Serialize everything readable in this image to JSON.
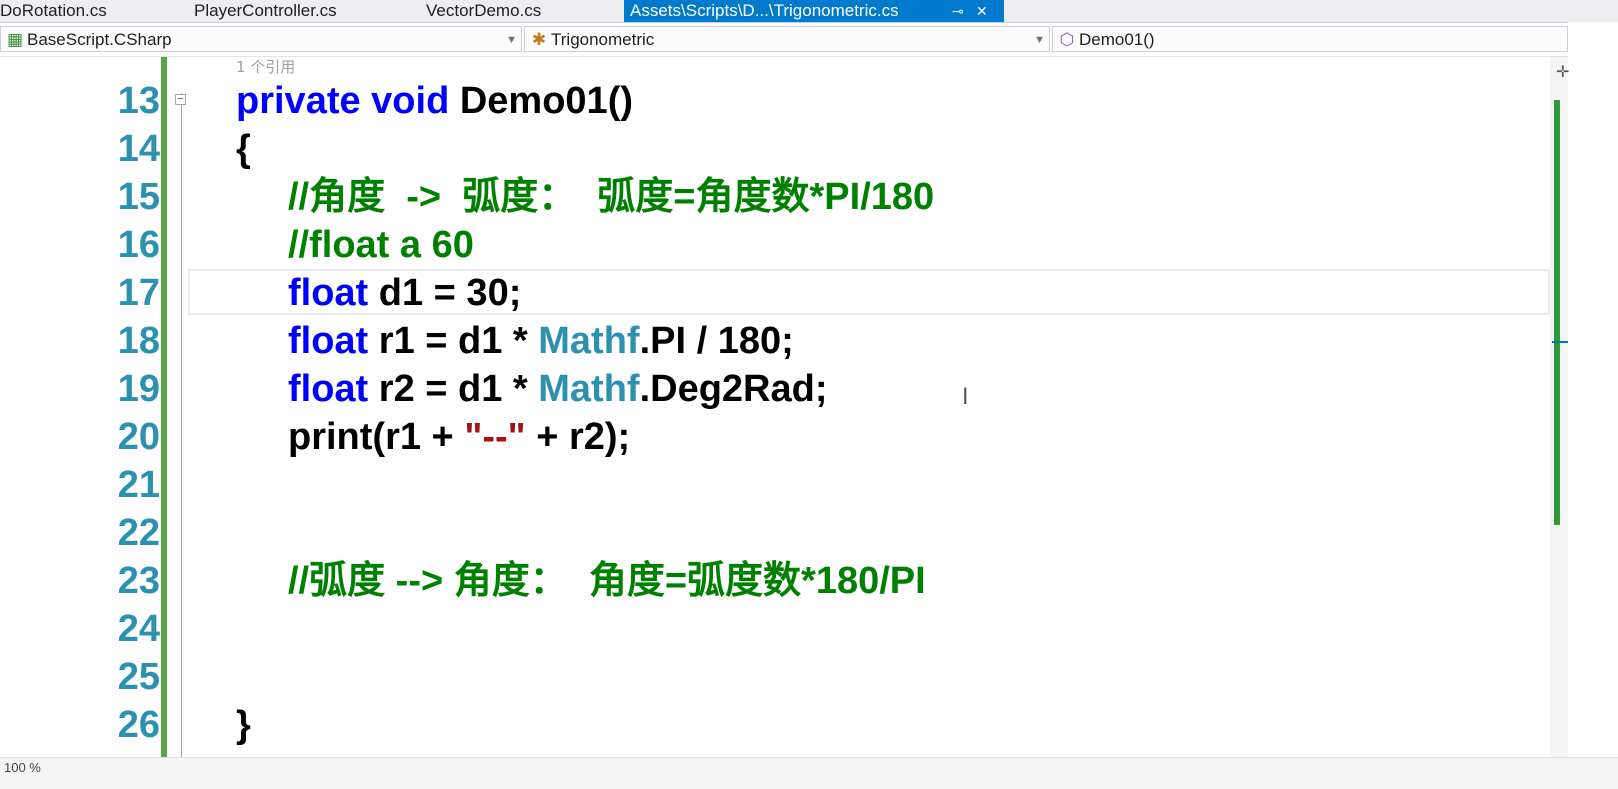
{
  "tabs": [
    {
      "label": "DoRotation.cs",
      "active": false
    },
    {
      "label": "PlayerController.cs",
      "active": false
    },
    {
      "label": "VectorDemo.cs",
      "active": false
    },
    {
      "label": "Assets\\Scripts\\D...\\Trigonometric.cs",
      "active": true
    }
  ],
  "tab_pin_icon": "pin-icon",
  "tab_close_icon": "close-icon",
  "nav": {
    "project": "BaseScript.CSharp",
    "class": "Trigonometric",
    "member": "Demo01()"
  },
  "editor": {
    "reference_hint": "1 个引用",
    "line_numbers": [
      "13",
      "14",
      "15",
      "16",
      "17",
      "18",
      "19",
      "20",
      "21",
      "22",
      "23",
      "24",
      "25",
      "26"
    ],
    "lines": [
      [
        {
          "t": "kw",
          "v": "private void "
        },
        {
          "t": "plain",
          "v": "Demo01()"
        }
      ],
      [
        {
          "t": "plain",
          "v": "{"
        }
      ],
      [
        {
          "t": "cm",
          "v": "//角度  ->  弧度：  弧度=角度数*PI/180"
        }
      ],
      [
        {
          "t": "cm",
          "v": "//float a 60"
        }
      ],
      [
        {
          "t": "kw",
          "v": "float "
        },
        {
          "t": "plain",
          "v": "d1 = 30;"
        }
      ],
      [
        {
          "t": "kw",
          "v": "float "
        },
        {
          "t": "plain",
          "v": "r1 = d1 * "
        },
        {
          "t": "type",
          "v": "Mathf"
        },
        {
          "t": "plain",
          "v": ".PI / 180;"
        }
      ],
      [
        {
          "t": "kw",
          "v": "float "
        },
        {
          "t": "plain",
          "v": "r2 = d1 * "
        },
        {
          "t": "type",
          "v": "Mathf"
        },
        {
          "t": "plain",
          "v": ".Deg2Rad;"
        }
      ],
      [
        {
          "t": "plain",
          "v": "print(r1 + "
        },
        {
          "t": "str",
          "v": "\"--\""
        },
        {
          "t": "plain",
          "v": " + r2);"
        }
      ],
      [],
      [],
      [
        {
          "t": "cm",
          "v": "//弧度 --> 角度：  角度=弧度数*180/PI"
        }
      ],
      [],
      [],
      [
        {
          "t": "plain",
          "v": "}"
        }
      ]
    ],
    "indent_levels": [
      0,
      0,
      1,
      1,
      1,
      1,
      1,
      1,
      0,
      0,
      1,
      0,
      0,
      0
    ],
    "current_line": "17"
  },
  "status": {
    "zoom": "100 %"
  },
  "colors": {
    "keyword": "#0000ff",
    "type": "#2b91af",
    "comment": "#008000",
    "string": "#a31515",
    "line_number": "#2b91af",
    "change_bar": "#57a64a",
    "active_tab": "#007acc"
  }
}
